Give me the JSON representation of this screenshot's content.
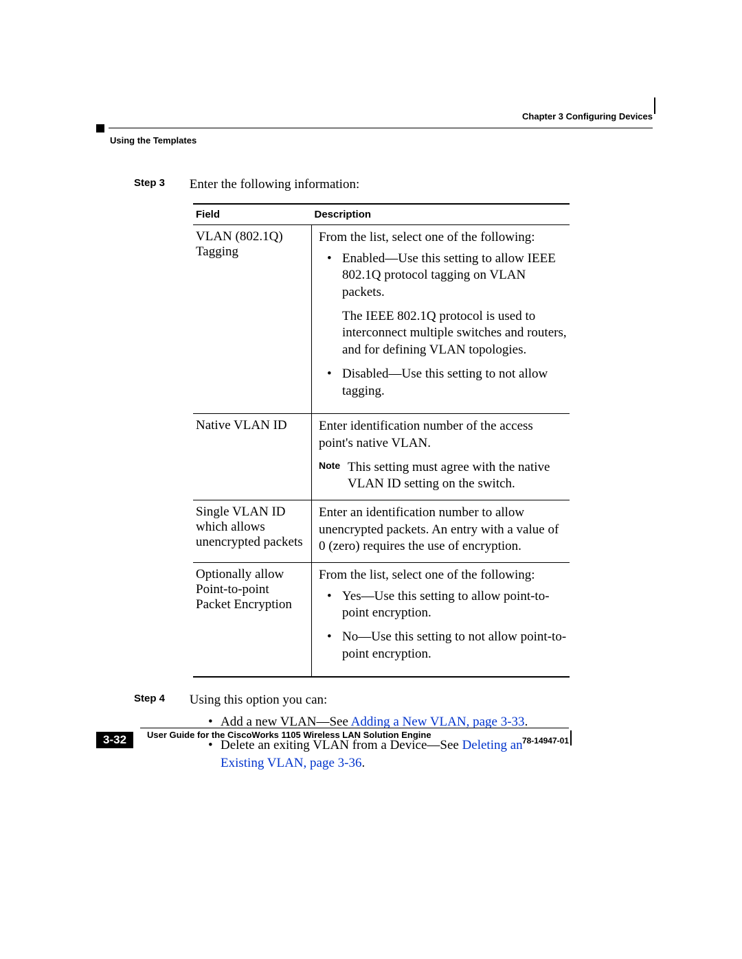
{
  "header": {
    "chapter": "Chapter 3      Configuring Devices",
    "section": "Using the Templates"
  },
  "step3": {
    "label": "Step 3",
    "text": "Enter the following information:"
  },
  "table": {
    "head_field": "Field",
    "head_desc": "Description",
    "rows": [
      {
        "field": "VLAN (802.1Q) Tagging",
        "intro": "From the list, select one of the following:",
        "bullets": [
          {
            "main": "Enabled—Use this setting to allow IEEE 802.1Q protocol tagging on VLAN packets.",
            "sub": "The IEEE 802.1Q protocol is used to interconnect multiple switches and routers, and for defining VLAN topologies."
          },
          {
            "main": "Disabled—Use this setting to not allow tagging."
          }
        ]
      },
      {
        "field": "Native VLAN ID",
        "intro": "Enter identification number of the access point's native VLAN.",
        "note_label": "Note",
        "note_text": "This setting must agree with the native VLAN ID setting on the switch."
      },
      {
        "field": "Single VLAN ID which allows unencrypted packets",
        "intro": "Enter an identification number to allow unencrypted packets. An entry with a value of 0 (zero) requires the use of encryption."
      },
      {
        "field": "Optionally allow Point-to-point Packet Encryption",
        "intro": "From the list, select one of the following:",
        "bullets": [
          {
            "main": "Yes—Use this setting to allow point-to-point encryption."
          },
          {
            "main": "No—Use this setting to not allow point-to-point encryption."
          }
        ]
      }
    ]
  },
  "step4": {
    "label": "Step 4",
    "text": "Using this option you can:",
    "bullets": [
      {
        "pre": "Add a new VLAN—See ",
        "link": "Adding a New VLAN, page 3-33",
        "post": "."
      },
      {
        "pre": "Delete an exiting VLAN from a Device—See ",
        "link": "Deleting an Existing VLAN, page 3-36",
        "post": "."
      }
    ]
  },
  "footer": {
    "title": "User Guide for the CiscoWorks 1105 Wireless LAN Solution Engine",
    "page": "3-32",
    "docnum": "78-14947-01"
  }
}
